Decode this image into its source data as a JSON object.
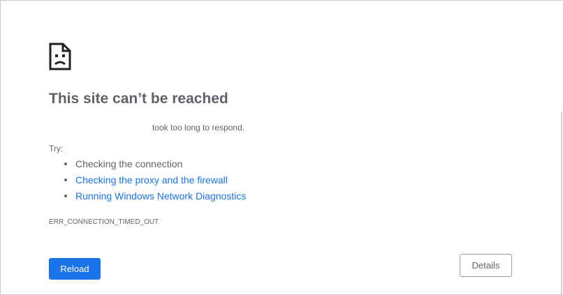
{
  "page": {
    "title": "This site can’t be reached",
    "description": "took too long to respond.",
    "try_label": "Try:",
    "error_code": "ERR_CONNECTION_TIMED_OUT"
  },
  "suggestions": [
    {
      "label": "Checking the connection",
      "link": false
    },
    {
      "label": "Checking the proxy and the firewall",
      "link": true
    },
    {
      "label": "Running Windows Network Diagnostics",
      "link": true
    }
  ],
  "buttons": {
    "reload_label": "Reload",
    "details_label": "Details"
  },
  "icons": {
    "error": "sad-page-icon"
  },
  "colors": {
    "primary": "#1a73e8",
    "text": "#5f6368",
    "link": "#1a73e8"
  }
}
